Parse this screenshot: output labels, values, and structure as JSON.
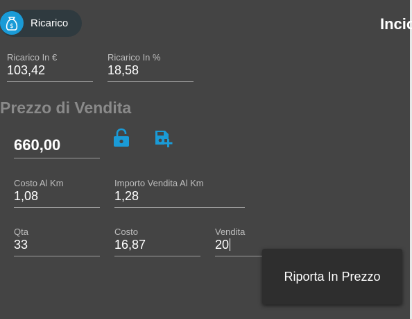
{
  "chip": {
    "label": "Ricarico",
    "icon": "money-bag-icon"
  },
  "title": "Incio",
  "ricarico": {
    "euro": {
      "label": "Ricarico In €",
      "value": "103,42"
    },
    "percent": {
      "label": "Ricarico In %",
      "value": "18,58"
    }
  },
  "section_title": "Prezzo di Vendita",
  "price": {
    "value": "660,00"
  },
  "icons": {
    "lock": "lock-open-icon",
    "save": "save-add-icon"
  },
  "km": {
    "costo": {
      "label": "Costo Al Km",
      "value": "1,08"
    },
    "importo": {
      "label": "Importo Vendita Al Km",
      "value": "1,28"
    }
  },
  "row3": {
    "qta": {
      "label": "Qta",
      "value": "33"
    },
    "costo": {
      "label": "Costo",
      "value": "16,87"
    },
    "vendita": {
      "label": "Vendita",
      "value": "20"
    }
  },
  "action_button": {
    "label": "Riporta In Prezzo"
  },
  "colors": {
    "background": "#444444",
    "accent": "#1a9bd7",
    "chip": "#2f3a3f",
    "button": "#2e2e2e"
  }
}
